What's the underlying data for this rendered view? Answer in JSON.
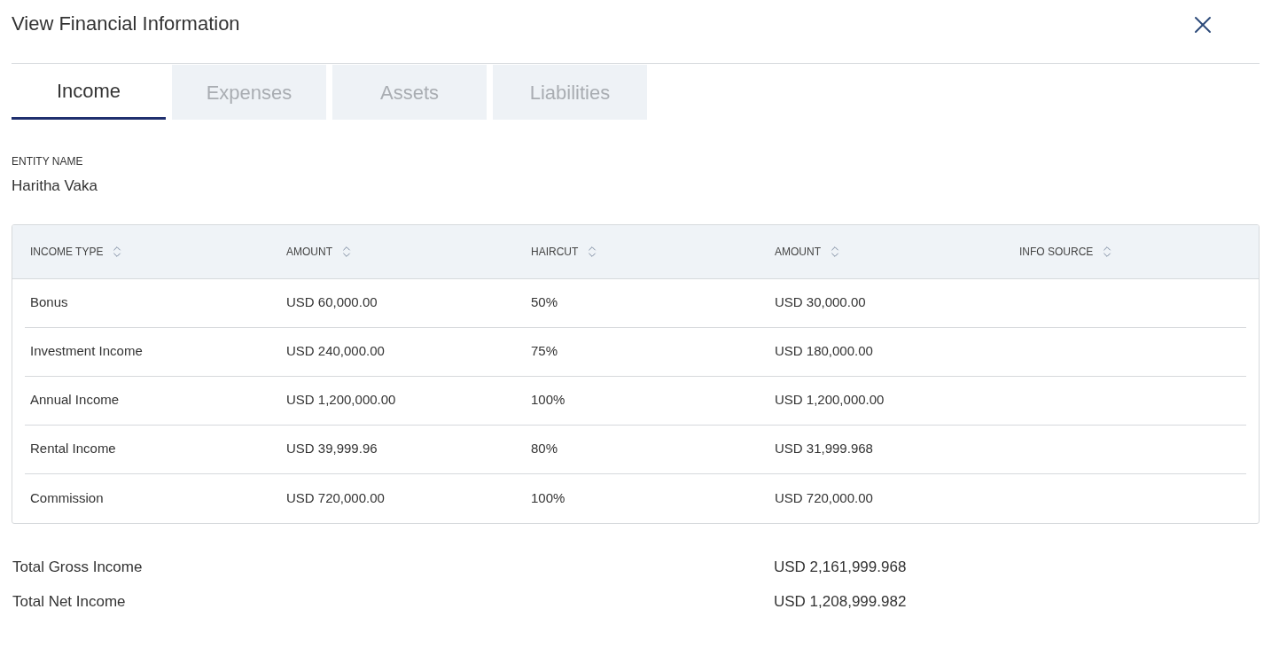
{
  "dialog": {
    "title": "View Financial Information"
  },
  "tabs": [
    {
      "label": "Income",
      "selected": true
    },
    {
      "label": "Expenses",
      "selected": false
    },
    {
      "label": "Assets",
      "selected": false
    },
    {
      "label": "Liabilities",
      "selected": false
    }
  ],
  "entity": {
    "label": "ENTITY NAME",
    "value": "Haritha Vaka"
  },
  "table": {
    "columns": [
      "INCOME TYPE",
      "AMOUNT",
      "HAIRCUT",
      "AMOUNT",
      "INFO SOURCE"
    ],
    "rows": [
      [
        "Bonus",
        "USD 60,000.00",
        "50%",
        "USD 30,000.00"
      ],
      [
        "Investment Income",
        "USD 240,000.00",
        "75%",
        "USD 180,000.00"
      ],
      [
        "Annual Income",
        "USD 1,200,000.00",
        "100%",
        "USD 1,200,000.00"
      ],
      [
        "Rental Income",
        "USD 39,999.96",
        "80%",
        "USD 31,999.968"
      ],
      [
        "Commission",
        "USD 720,000.00",
        "100%",
        "USD 720,000.00"
      ]
    ]
  },
  "totals": [
    {
      "label": "Total Gross Income",
      "value": "USD 2,161,999.968"
    },
    {
      "label": "Total Net Income",
      "value": "USD 1,208,999.982"
    }
  ]
}
